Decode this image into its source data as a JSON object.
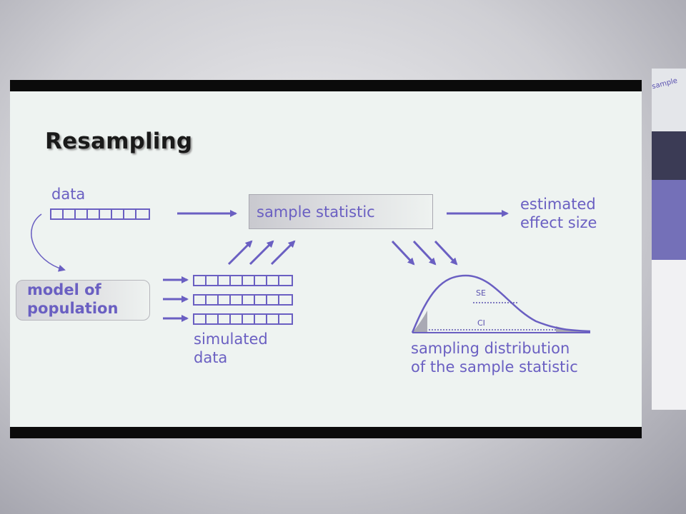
{
  "slide": {
    "title": "Resampling",
    "data_label": "data",
    "statistic_label": "sample statistic",
    "estimate_label_line1": "estimated",
    "estimate_label_line2": "effect size",
    "model_label_line1": "model of",
    "model_label_line2": "population",
    "simulated_label_line1": "simulated",
    "simulated_label_line2": "data",
    "se_label": "SE",
    "ci_label": "CI",
    "dist_label_line1": "sampling distribution",
    "dist_label_line2": "of the sample statistic",
    "cells_per_row": 8
  },
  "side_panel": {
    "note_text": "sample"
  },
  "colors": {
    "accent": "#6a5fc2",
    "frame": "#0b0b0b",
    "slide_bg": "#eef3f1"
  }
}
